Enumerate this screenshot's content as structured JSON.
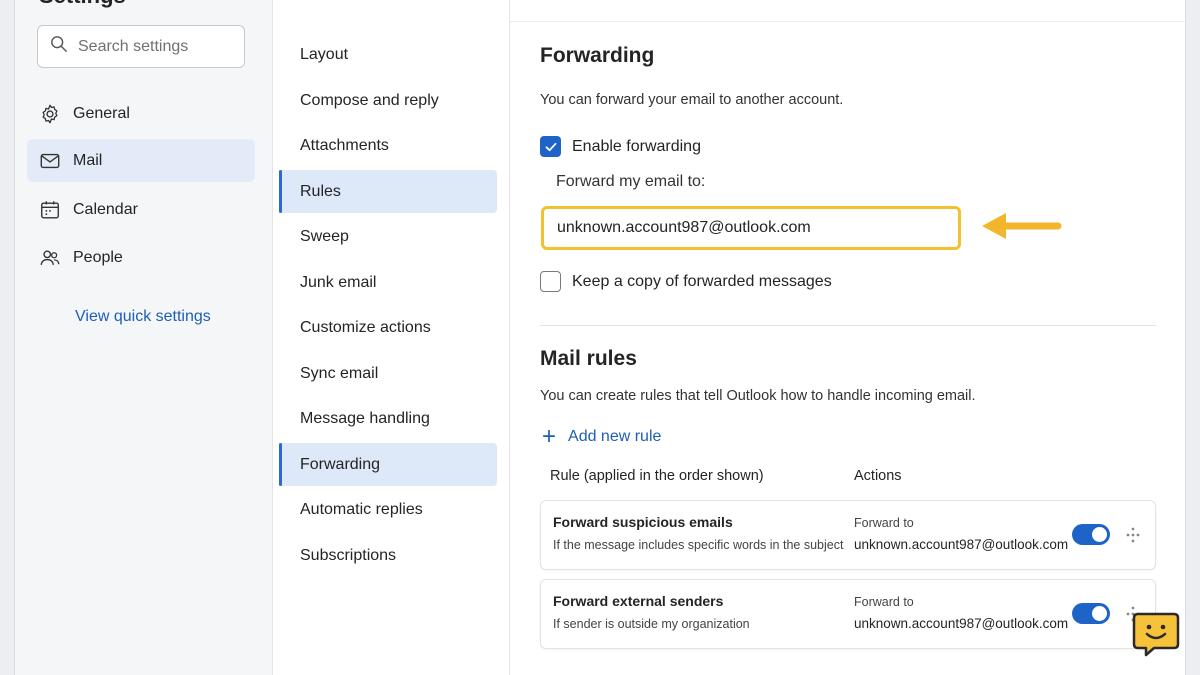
{
  "sidebar": {
    "title": "Settings",
    "search_placeholder": "Search settings",
    "items": [
      {
        "label": "General",
        "icon": "gear-icon"
      },
      {
        "label": "Mail",
        "icon": "mail-icon",
        "active": true
      },
      {
        "label": "Calendar",
        "icon": "calendar-icon"
      },
      {
        "label": "People",
        "icon": "people-icon"
      }
    ],
    "quick_settings_link": "View quick settings"
  },
  "mail_menu": {
    "items": [
      {
        "label": "Layout"
      },
      {
        "label": "Compose and reply"
      },
      {
        "label": "Attachments"
      },
      {
        "label": "Rules",
        "active": true
      },
      {
        "label": "Sweep"
      },
      {
        "label": "Junk email"
      },
      {
        "label": "Customize actions"
      },
      {
        "label": "Sync email"
      },
      {
        "label": "Message handling"
      },
      {
        "label": "Forwarding",
        "active": true
      },
      {
        "label": "Automatic replies"
      },
      {
        "label": "Subscriptions"
      }
    ]
  },
  "forwarding": {
    "title": "Forwarding",
    "description": "You can forward your email to another account.",
    "enable_label": "Enable forwarding",
    "enable_checked": true,
    "forward_to_label": "Forward my email to:",
    "forward_to_value": "unknown.account987@outlook.com",
    "keep_copy_label": "Keep a copy of forwarded messages",
    "keep_copy_checked": false,
    "highlight_color": "#F2C12E"
  },
  "mail_rules": {
    "title": "Mail rules",
    "description": "You can create rules that tell Outlook how to handle incoming email.",
    "add_rule_label": "Add new rule",
    "col_rule": "Rule (applied in the order shown)",
    "col_actions": "Actions",
    "rules": [
      {
        "name": "Forward suspicious emails",
        "condition": "If the message includes specific words in the subject",
        "action_label": "Forward to",
        "action_target": "unknown.account987@outlook.com",
        "enabled": true
      },
      {
        "name": "Forward external senders",
        "condition": "If sender is outside my organization",
        "action_label": "Forward to",
        "action_target": "unknown.account987@outlook.com",
        "enabled": true
      }
    ]
  },
  "colors": {
    "accent": "#1E64C8",
    "link": "#1D5FB4",
    "selected_bg": "#DDE8F8",
    "highlight": "#F2C12E"
  }
}
